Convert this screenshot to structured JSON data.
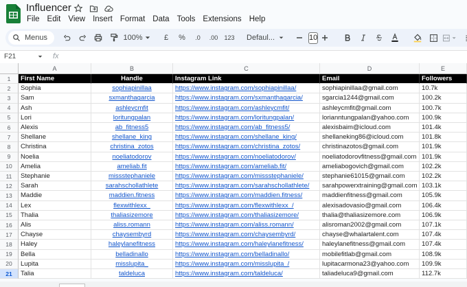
{
  "app": {
    "title": "Influencer"
  },
  "menu": [
    "File",
    "Edit",
    "View",
    "Insert",
    "Format",
    "Data",
    "Tools",
    "Extensions",
    "Help"
  ],
  "toolbar": {
    "menus_label": "Menus",
    "zoom": "100%",
    "currency": "£",
    "percent": "%",
    "dec_dec": ".0",
    "dec_inc": ".00",
    "number_format": "123",
    "font": "Defaul...",
    "font_size": "10"
  },
  "formula_bar": {
    "cell_ref": "F21",
    "fx": "fx"
  },
  "columns": [
    "A",
    "B",
    "C",
    "D",
    "E"
  ],
  "header_row": {
    "first_name": "First Name",
    "handle": "Handle",
    "instagram_link": "Instagram Link",
    "email": "Email",
    "followers": "Followers"
  },
  "rows": [
    {
      "n": "2",
      "first_name": "Sophia",
      "handle": "sophiapinillaa",
      "link": "https://www.instagram.com/sophiapinillaa/",
      "email": "sophiapinillaa@gmail.com",
      "followers": "10.7k"
    },
    {
      "n": "3",
      "first_name": "Sam",
      "handle": "sxmanthagarcia",
      "link": "https://www.instagram.com/sxmanthagarcia/",
      "email": "sgarcia1244@gmail.com",
      "followers": "100.2k"
    },
    {
      "n": "4",
      "first_name": "Ash",
      "handle": "ashleycmfit",
      "link": "https://www.instagram.com/ashleycmfit/",
      "email": "ashleycmfit@gmail.com",
      "followers": "100.7k"
    },
    {
      "n": "5",
      "first_name": "Lori",
      "handle": "loritungpalan",
      "link": "https://www.instagram.com/loritungpalan/",
      "email": "lorianntungpalan@yahoo.com",
      "followers": "100.9k"
    },
    {
      "n": "6",
      "first_name": "Alexis",
      "handle": "ab_fitness5",
      "link": "https://www.instagram.com/ab_fitness5/",
      "email": "alexisbaim@icloud.com",
      "followers": "101.4k"
    },
    {
      "n": "7",
      "first_name": "Shellane",
      "handle": "shellane_king",
      "link": "https://www.instagram.com/shellane_king/",
      "email": "shellaneking86@icloud.com",
      "followers": "101.8k"
    },
    {
      "n": "8",
      "first_name": "Christina",
      "handle": "christina_zotos",
      "link": "https://www.instagram.com/christina_zotos/",
      "email": "christinazotos@gmail.com",
      "followers": "101.9k"
    },
    {
      "n": "9",
      "first_name": "Noelia",
      "handle": "noeliatodorov",
      "link": "https://www.instagram.com/noeliatodorov/",
      "email": "noeliatodorovfitness@gmail.com",
      "followers": "101.9k"
    },
    {
      "n": "10",
      "first_name": "Amelia",
      "handle": "ameliab.fit",
      "link": "https://www.instagram.com/ameliab.fit/",
      "email": "ameliabogovich@gmail.com",
      "followers": "102.2k"
    },
    {
      "n": "11",
      "first_name": "Stephanie",
      "handle": "missstephaniele",
      "link": "https://www.instagram.com/missstephaniele/",
      "email": "stephanie61015@gmail.com",
      "followers": "102.2k"
    },
    {
      "n": "12",
      "first_name": "Sarah",
      "handle": "sarahschollathlete",
      "link": "https://www.instagram.com/sarahschollathlete/",
      "email": "sarahpowerxtraining@gmail.com",
      "followers": "103.1k"
    },
    {
      "n": "13",
      "first_name": "Maddie",
      "handle": "maddien.fitness",
      "link": "https://www.instagram.com/maddien.fitness/",
      "email": "maddienfitness@gmail.com",
      "followers": "105.9k"
    },
    {
      "n": "14",
      "first_name": "Lex",
      "handle": "flexwithlexx_",
      "link": "https://www.instagram.com/flexwithlexx_/",
      "email": "alexisadovasio@gmail.com",
      "followers": "106.4k"
    },
    {
      "n": "15",
      "first_name": "Thalia",
      "handle": "thaliasizemore",
      "link": "https://www.instagram.com/thaliasizemore/",
      "email": "thalia@thaliasizemore.com",
      "followers": "106.9k"
    },
    {
      "n": "16",
      "first_name": "Alis",
      "handle": "aliss.romann",
      "link": "https://www.instagram.com/aliss.romann/",
      "email": "alisroman2002@gmail.com",
      "followers": "107.1k"
    },
    {
      "n": "17",
      "first_name": "Chayse",
      "handle": "chaysembyrd",
      "link": "https://www.instagram.com/chaysembyrd/",
      "email": "chayse@whalartalent.com",
      "followers": "107.4k"
    },
    {
      "n": "18",
      "first_name": "Haley",
      "handle": "haleylanefitness",
      "link": "https://www.instagram.com/haleylanefitness/",
      "email": "haleylanefitness@gmail.com",
      "followers": "107.4k"
    },
    {
      "n": "19",
      "first_name": "Bella",
      "handle": "belladinallo",
      "link": "https://www.instagram.com/belladinallo/",
      "email": "mobilefitlab@gmail.com",
      "followers": "108.9k"
    },
    {
      "n": "20",
      "first_name": "Lupita",
      "handle": "misslupita_",
      "link": "https://www.instagram.com/misslupita_/",
      "email": "lupitacarmona23@yahoo.com",
      "followers": "109.9k"
    },
    {
      "n": "21",
      "first_name": "Talia",
      "handle": "taldeluca",
      "link": "https://www.instagram.com/taldeluca/",
      "email": "taliadeluca9@gmail.com",
      "followers": "112.7k"
    }
  ],
  "colors": {
    "link": "#1155cc",
    "header_bg": "#000000",
    "selected_row": "#d3e3fd",
    "sheets_green": "#188038"
  }
}
